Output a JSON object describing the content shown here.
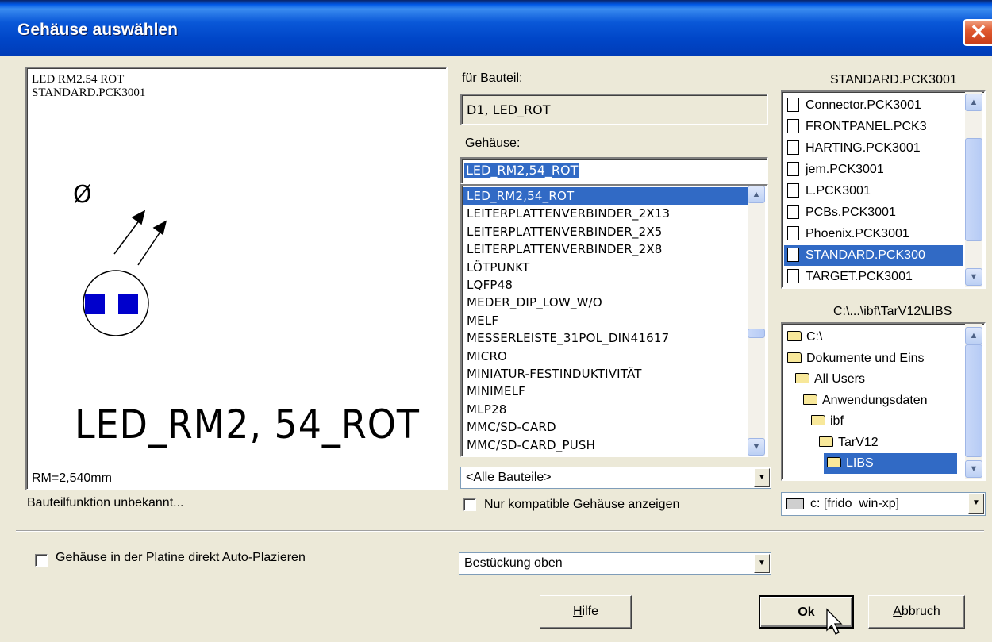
{
  "window": {
    "title": "Gehäuse auswählen",
    "close_glyph": "✕"
  },
  "preview": {
    "line1": "LED RM2.54 ROT",
    "line2": "STANDARD.PCK3001",
    "symbol_label": "Ø",
    "footprint_name": "LED_RM2, 54_ROT",
    "pad_color": "#0000cc",
    "rm_text": "RM=2,540mm",
    "function_text": "Bauteilfunktion unbekannt..."
  },
  "part": {
    "label": "für Bauteil:",
    "value": "D1, LED_ROT"
  },
  "package": {
    "label": "Gehäuse:",
    "input_value": "LED_RM2,54_ROT",
    "items": [
      "LED_RM2,54_ROT",
      "LEITERPLATTENVERBINDER_2X13",
      "LEITERPLATTENVERBINDER_2X5",
      "LEITERPLATTENVERBINDER_2X8",
      "LÖTPUNKT",
      "LQFP48",
      "MEDER_DIP_LOW_W/O",
      "MELF",
      "MESSERLEISTE_31POL_DIN41617",
      "MICRO",
      "MINIATUR-FESTINDUKTIVITÄT",
      "MINIMELF",
      "MLP28",
      "MMC/SD-CARD",
      "MMC/SD-CARD_PUSH"
    ],
    "selected_index": 0,
    "filter_value": "<Alle Bauteile>",
    "compat_label": "Nur kompatible Gehäuse anzeigen"
  },
  "libraries": {
    "header": "STANDARD.PCK3001",
    "items": [
      "Connector.PCK3001",
      "FRONTPANEL.PCK3",
      "HARTING.PCK3001",
      "jem.PCK3001",
      "L.PCK3001",
      "PCBs.PCK3001",
      "Phoenix.PCK3001",
      "STANDARD.PCK300",
      "TARGET.PCK3001"
    ],
    "selected_index": 7,
    "icon": "document-icon"
  },
  "folders": {
    "header": "C:\\...\\ibf\\TarV12\\LIBS",
    "items": [
      {
        "label": "C:\\",
        "level": 0
      },
      {
        "label": "Dokumente und Eins",
        "level": 0
      },
      {
        "label": "All Users",
        "level": 1
      },
      {
        "label": "Anwendungsdaten",
        "level": 2
      },
      {
        "label": "ibf",
        "level": 3
      },
      {
        "label": "TarV12",
        "level": 4
      },
      {
        "label": "LIBS",
        "level": 5
      }
    ],
    "selected_index": 6,
    "drive_value": "c: [frido_win-xp]"
  },
  "bottom": {
    "autoplace_label": "Gehäuse in der Platine direkt Auto-Plazieren",
    "placement_value": "Bestückung oben",
    "help_prefix": "",
    "help_underlined": "H",
    "help_rest": "ilfe",
    "ok_underlined": "O",
    "ok_rest": "k",
    "cancel_underlined": "A",
    "cancel_rest": "bbruch"
  },
  "colors": {
    "selection": "#316ac5",
    "face": "#ece9d8"
  }
}
